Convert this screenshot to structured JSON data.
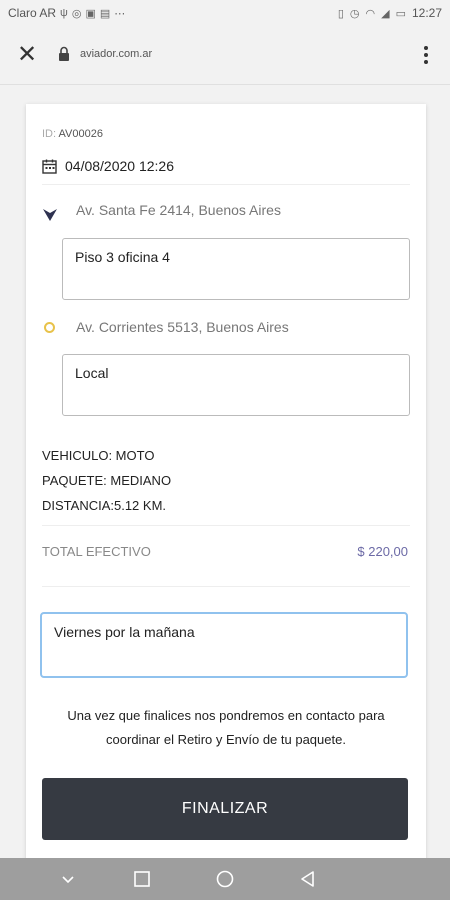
{
  "status_bar": {
    "carrier": "Claro AR",
    "time": "12:27",
    "left_icons": [
      "usb-icon",
      "whatsapp-icon",
      "message-icon",
      "gallery-icon",
      "more-dots-icon"
    ],
    "right_icons": [
      "vibrate-icon",
      "alarm-icon",
      "wifi-icon",
      "signal-icon",
      "battery-icon"
    ]
  },
  "browser": {
    "url": "aviador.com.ar",
    "close_icon": "close-icon",
    "lock_icon": "lock-icon",
    "menu_icon": "more-vert-icon"
  },
  "order": {
    "id_label": "ID:",
    "id_value": "AV00026",
    "datetime": "04/08/2020 12:26",
    "pickup_address": "Av. Santa Fe 2414, Buenos Aires",
    "pickup_detail": "Piso 3 oficina 4",
    "dropoff_address": "Av. Corrientes 5513, Buenos Aires",
    "dropoff_detail": "Local",
    "vehicle": "VEHICULO: MOTO",
    "package": "PAQUETE: MEDIANO",
    "distance": "DISTANCIA:5.12 KM.",
    "total_label": "TOTAL EFECTIVO",
    "total_value": "$ 220,00",
    "notes_value": "Viernes por la mañana",
    "message_line1": "Una vez que finalices nos pondremos en contacto para",
    "message_line2": "coordinar el Retiro y Envío de tu paquete.",
    "submit_label": "FINALIZAR"
  },
  "colors": {
    "accent_price": "#6c6aa6",
    "pickup_pin": "#2e3150",
    "dropoff_pin": "#e8c24a",
    "button_bg": "#363a42",
    "focus_border": "#90c2ee"
  },
  "nav_bar": [
    "chevron-down-icon",
    "recents-icon",
    "home-icon",
    "back-icon"
  ]
}
